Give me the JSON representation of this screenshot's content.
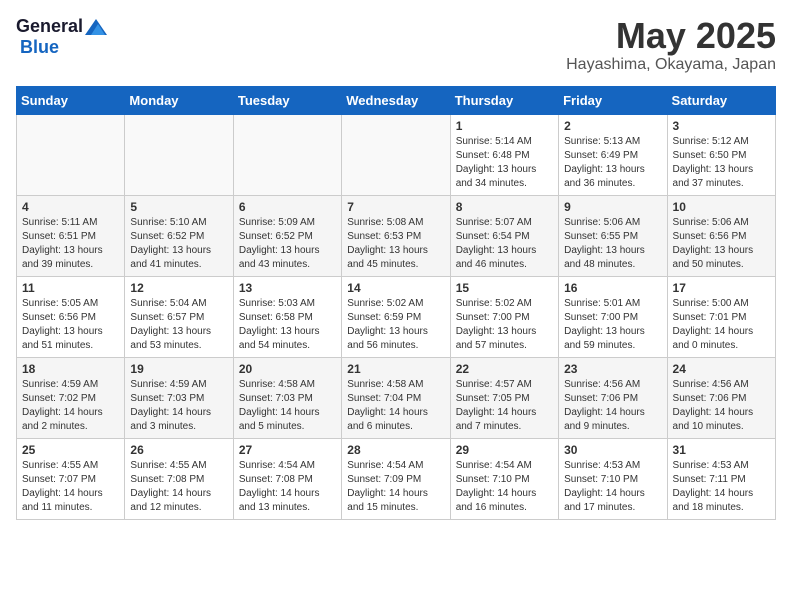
{
  "logo": {
    "general": "General",
    "blue": "Blue"
  },
  "title": "May 2025",
  "location": "Hayashima, Okayama, Japan",
  "weekdays": [
    "Sunday",
    "Monday",
    "Tuesday",
    "Wednesday",
    "Thursday",
    "Friday",
    "Saturday"
  ],
  "weeks": [
    [
      {
        "day": "",
        "info": ""
      },
      {
        "day": "",
        "info": ""
      },
      {
        "day": "",
        "info": ""
      },
      {
        "day": "",
        "info": ""
      },
      {
        "day": "1",
        "info": "Sunrise: 5:14 AM\nSunset: 6:48 PM\nDaylight: 13 hours\nand 34 minutes."
      },
      {
        "day": "2",
        "info": "Sunrise: 5:13 AM\nSunset: 6:49 PM\nDaylight: 13 hours\nand 36 minutes."
      },
      {
        "day": "3",
        "info": "Sunrise: 5:12 AM\nSunset: 6:50 PM\nDaylight: 13 hours\nand 37 minutes."
      }
    ],
    [
      {
        "day": "4",
        "info": "Sunrise: 5:11 AM\nSunset: 6:51 PM\nDaylight: 13 hours\nand 39 minutes."
      },
      {
        "day": "5",
        "info": "Sunrise: 5:10 AM\nSunset: 6:52 PM\nDaylight: 13 hours\nand 41 minutes."
      },
      {
        "day": "6",
        "info": "Sunrise: 5:09 AM\nSunset: 6:52 PM\nDaylight: 13 hours\nand 43 minutes."
      },
      {
        "day": "7",
        "info": "Sunrise: 5:08 AM\nSunset: 6:53 PM\nDaylight: 13 hours\nand 45 minutes."
      },
      {
        "day": "8",
        "info": "Sunrise: 5:07 AM\nSunset: 6:54 PM\nDaylight: 13 hours\nand 46 minutes."
      },
      {
        "day": "9",
        "info": "Sunrise: 5:06 AM\nSunset: 6:55 PM\nDaylight: 13 hours\nand 48 minutes."
      },
      {
        "day": "10",
        "info": "Sunrise: 5:06 AM\nSunset: 6:56 PM\nDaylight: 13 hours\nand 50 minutes."
      }
    ],
    [
      {
        "day": "11",
        "info": "Sunrise: 5:05 AM\nSunset: 6:56 PM\nDaylight: 13 hours\nand 51 minutes."
      },
      {
        "day": "12",
        "info": "Sunrise: 5:04 AM\nSunset: 6:57 PM\nDaylight: 13 hours\nand 53 minutes."
      },
      {
        "day": "13",
        "info": "Sunrise: 5:03 AM\nSunset: 6:58 PM\nDaylight: 13 hours\nand 54 minutes."
      },
      {
        "day": "14",
        "info": "Sunrise: 5:02 AM\nSunset: 6:59 PM\nDaylight: 13 hours\nand 56 minutes."
      },
      {
        "day": "15",
        "info": "Sunrise: 5:02 AM\nSunset: 7:00 PM\nDaylight: 13 hours\nand 57 minutes."
      },
      {
        "day": "16",
        "info": "Sunrise: 5:01 AM\nSunset: 7:00 PM\nDaylight: 13 hours\nand 59 minutes."
      },
      {
        "day": "17",
        "info": "Sunrise: 5:00 AM\nSunset: 7:01 PM\nDaylight: 14 hours\nand 0 minutes."
      }
    ],
    [
      {
        "day": "18",
        "info": "Sunrise: 4:59 AM\nSunset: 7:02 PM\nDaylight: 14 hours\nand 2 minutes."
      },
      {
        "day": "19",
        "info": "Sunrise: 4:59 AM\nSunset: 7:03 PM\nDaylight: 14 hours\nand 3 minutes."
      },
      {
        "day": "20",
        "info": "Sunrise: 4:58 AM\nSunset: 7:03 PM\nDaylight: 14 hours\nand 5 minutes."
      },
      {
        "day": "21",
        "info": "Sunrise: 4:58 AM\nSunset: 7:04 PM\nDaylight: 14 hours\nand 6 minutes."
      },
      {
        "day": "22",
        "info": "Sunrise: 4:57 AM\nSunset: 7:05 PM\nDaylight: 14 hours\nand 7 minutes."
      },
      {
        "day": "23",
        "info": "Sunrise: 4:56 AM\nSunset: 7:06 PM\nDaylight: 14 hours\nand 9 minutes."
      },
      {
        "day": "24",
        "info": "Sunrise: 4:56 AM\nSunset: 7:06 PM\nDaylight: 14 hours\nand 10 minutes."
      }
    ],
    [
      {
        "day": "25",
        "info": "Sunrise: 4:55 AM\nSunset: 7:07 PM\nDaylight: 14 hours\nand 11 minutes."
      },
      {
        "day": "26",
        "info": "Sunrise: 4:55 AM\nSunset: 7:08 PM\nDaylight: 14 hours\nand 12 minutes."
      },
      {
        "day": "27",
        "info": "Sunrise: 4:54 AM\nSunset: 7:08 PM\nDaylight: 14 hours\nand 13 minutes."
      },
      {
        "day": "28",
        "info": "Sunrise: 4:54 AM\nSunset: 7:09 PM\nDaylight: 14 hours\nand 15 minutes."
      },
      {
        "day": "29",
        "info": "Sunrise: 4:54 AM\nSunset: 7:10 PM\nDaylight: 14 hours\nand 16 minutes."
      },
      {
        "day": "30",
        "info": "Sunrise: 4:53 AM\nSunset: 7:10 PM\nDaylight: 14 hours\nand 17 minutes."
      },
      {
        "day": "31",
        "info": "Sunrise: 4:53 AM\nSunset: 7:11 PM\nDaylight: 14 hours\nand 18 minutes."
      }
    ]
  ]
}
